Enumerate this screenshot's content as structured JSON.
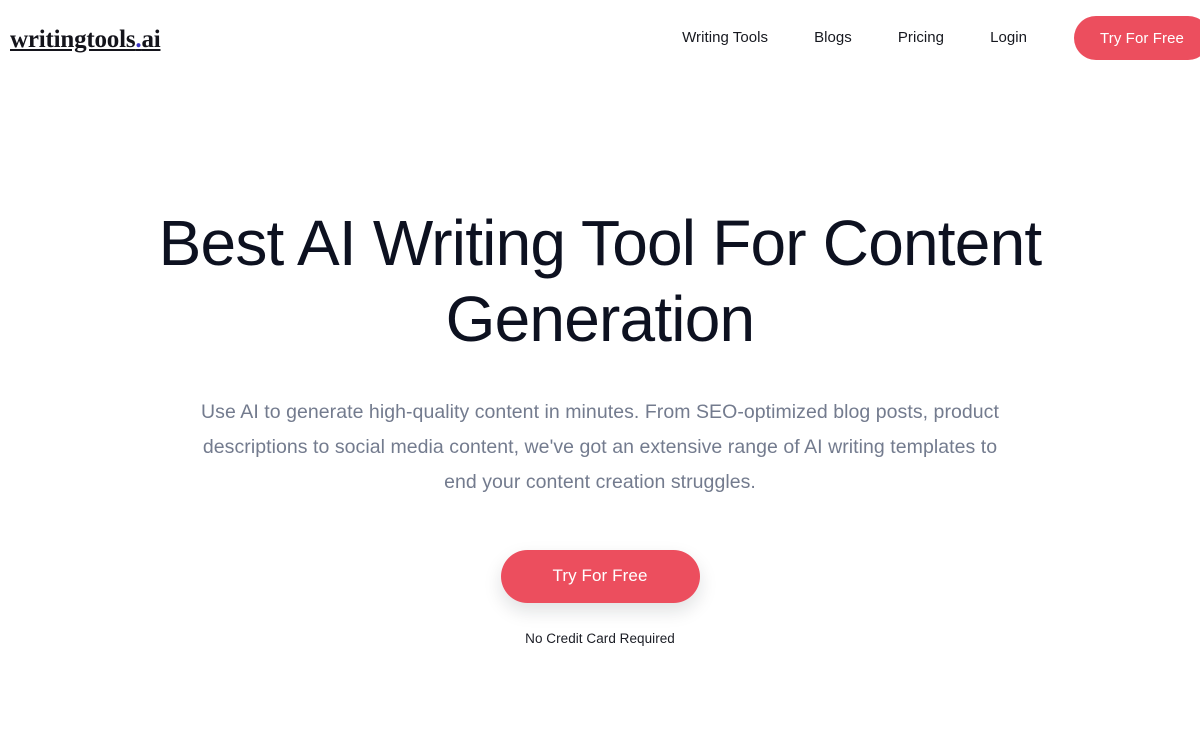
{
  "header": {
    "brand": {
      "name_part_one": "writingtools",
      "dot": ".",
      "name_part_two": "ai",
      "dot_color": "#3a33c4"
    },
    "nav_links": [
      {
        "label": "Writing Tools"
      },
      {
        "label": "Blogs"
      },
      {
        "label": "Pricing"
      },
      {
        "label": "Login"
      }
    ],
    "cta_label": "Try For Free"
  },
  "hero": {
    "title_line_one": "Best AI Writing Tool For Content",
    "title_line_two": "Generation",
    "subtitle": "Use AI to generate high-quality content in minutes. From SEO-optimized blog posts, product descriptions to social media content, we've got an extensive range of AI writing templates to end your content creation struggles.",
    "cta_label": "Try For Free",
    "cta_note": "No Credit Card Required"
  },
  "colors": {
    "accent_red": "#ec4e5e",
    "heading_dark": "#0d1120",
    "body_gray": "#737b8e",
    "background": "#ffffff"
  }
}
